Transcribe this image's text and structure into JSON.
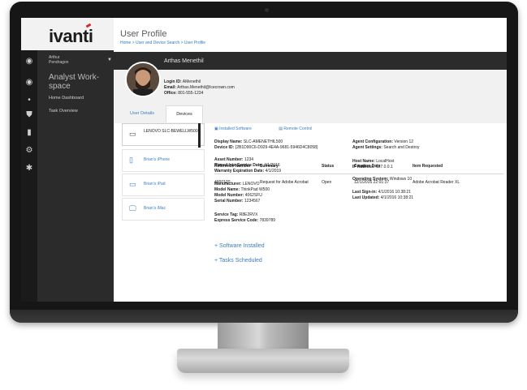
{
  "app": {
    "logo": "ivanti",
    "page_title": "User Profile",
    "breadcrumb": "Home > User and Device Search > User Profile"
  },
  "sidebar": {
    "user_name": "Arthur\nPendragon",
    "workspace_title": "Analyst Work- space",
    "items": [
      {
        "label": "Home Dashboard"
      },
      {
        "label": "Task Overview"
      }
    ]
  },
  "profile": {
    "name": "Arthas Menethil",
    "login_label": "Login ID:",
    "login_value": "AMenethil",
    "email_label": "Email:",
    "email_value": "Arthas.Menethil@Icecrown.com",
    "office_label": "Office:",
    "office_value": "801-555-1234"
  },
  "tabs": [
    {
      "label": "User Details"
    },
    {
      "label": "Devices"
    }
  ],
  "devices": [
    {
      "label": "LENOVO SLC-BEWELLW500",
      "icon": "laptop-icon"
    },
    {
      "label": "Brian's iPhone",
      "icon": "phone-icon"
    },
    {
      "label": "Brian's iPad",
      "icon": "tablet-icon"
    },
    {
      "label": "Brian's iMac",
      "icon": "desktop-icon"
    }
  ],
  "actions": {
    "installed_software": "Installed Software",
    "remote_control": "Remote Control"
  },
  "details": {
    "display_name": {
      "label": "Display Name:",
      "value": "SLC-AMENETHIL500"
    },
    "device_id": {
      "label": "Device ID:",
      "value": "{2B1D90C6-D929-4E4A-9681-5946D4C8058}"
    },
    "asset_number": {
      "label": "Asset Number:",
      "value": "1234"
    },
    "placed_into_service": {
      "label": "Placed Into Service Date:",
      "value": "4/1/2016"
    },
    "warranty_expiration": {
      "label": "Warranty Expiration Date:",
      "value": "4/1/2019"
    },
    "manufacturer": {
      "label": "Manufacturer:",
      "value": "LENOVO"
    },
    "model_name": {
      "label": "Model Name:",
      "value": "ThinkPad W500"
    },
    "model_number": {
      "label": "Model Number:",
      "value": "4062SFU"
    },
    "serial_number": {
      "label": "Serial Number:",
      "value": "1234567"
    },
    "service_tag": {
      "label": "Service Tag:",
      "value": "R8E2RVX"
    },
    "express_code": {
      "label": "Express Service Code:",
      "value": "7839789"
    },
    "agent_config": {
      "label": "Agent Configuration:",
      "value": "Version 12"
    },
    "agent_settings": {
      "label": "Agent Settings:",
      "value": "Search and Destroy"
    },
    "host_name": {
      "label": "Host Name:",
      "value": "LocalHost"
    },
    "ip_address": {
      "label": "IP Address:",
      "value": "127.0.0.1"
    },
    "os": {
      "label": "Operating System:",
      "value": "Windows 10"
    },
    "last_signin": {
      "label": "Last Sign-in:",
      "value": "4/1/2016 10:38:21"
    },
    "last_updated": {
      "label": "Last Updated:",
      "value": "4/1/2016 10:38:21"
    }
  },
  "sections": {
    "software": "+ Software Installed",
    "tasks": "+ Tasks Scheduled"
  },
  "table": {
    "headers": [
      "Reference Number",
      "Summary",
      "Status",
      "Creation Date",
      "Item Requested"
    ],
    "rows": [
      [
        "4000120",
        "Request for Adobe Acrobat",
        "Open",
        "12/1/2016 22:01:37",
        "Adobe Acrobat Reader XL"
      ]
    ]
  },
  "colors": {
    "accent": "#3b7fc0",
    "sidebar": "#2b2b2b",
    "brand_red": "#d9262b"
  }
}
